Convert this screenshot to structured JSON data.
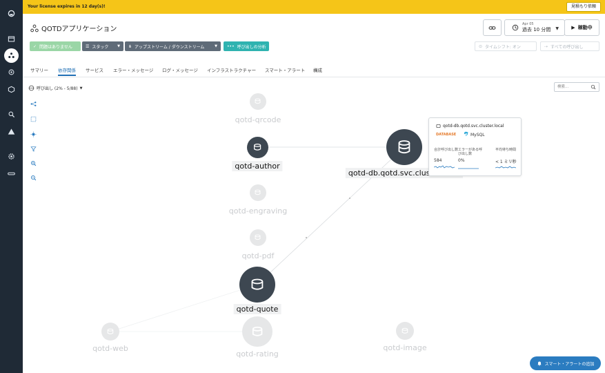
{
  "banner": {
    "message": "Your license expires in 12 day(s)!",
    "quote_button": "見積もり依頼"
  },
  "app": {
    "title": "QOTDアプリケーション",
    "icon": "application-icon"
  },
  "time": {
    "date": "Apr 05",
    "range": "過去 10 分間",
    "live": "稼動中"
  },
  "filters": {
    "problems": "問題はありません",
    "stack": "スタック",
    "upstream": "アップストリーム / ダウンストリーム",
    "call_analysis": "呼び出しの分析",
    "timeshift": "タイムシフト: オン",
    "all_calls": "すべての呼び出し"
  },
  "tabs": [
    {
      "label": "サマリー"
    },
    {
      "label": "依存関係"
    },
    {
      "label": "サービス"
    },
    {
      "label": "エラー・メッセージ"
    },
    {
      "label": "ログ・メッセージ"
    },
    {
      "label": "インフラストラクチャー"
    },
    {
      "label": "スマート・アラート"
    },
    {
      "label": "構成"
    }
  ],
  "toolbar": {
    "grouping": "呼び出し (2% - 5/88)",
    "search_placeholder": "検索..."
  },
  "nodes": [
    {
      "label": "qotd-qrcode"
    },
    {
      "label": "qotd-author"
    },
    {
      "label": "qotd-db.qotd.svc.cluster.local"
    },
    {
      "label": "qotd-engraving"
    },
    {
      "label": "qotd-pdf"
    },
    {
      "label": "qotd-quote"
    },
    {
      "label": "qotd-web"
    },
    {
      "label": "qotd-rating"
    },
    {
      "label": "qotd-image"
    }
  ],
  "tooltip": {
    "name": "qotd-db.qotd.svc.cluster.local",
    "type": "DATABASE",
    "tech": "MySQL",
    "metrics": [
      {
        "header": "合計呼び出し数",
        "value": "584"
      },
      {
        "header": "エラーがある呼び出し数",
        "value": "0%"
      },
      {
        "header": "平均待ち時間",
        "value": "< 1 ミリ秒"
      }
    ]
  },
  "smart_alert_button": "スマート・アラートの追加",
  "colors": {
    "banner": "#f5c518",
    "nav": "#1f2a36",
    "accent": "#2b7cc0",
    "teal": "#2fb3b0",
    "node_dark": "#3d4751",
    "node_ghost": "#e6e7e8",
    "database": "#e57a2a"
  }
}
